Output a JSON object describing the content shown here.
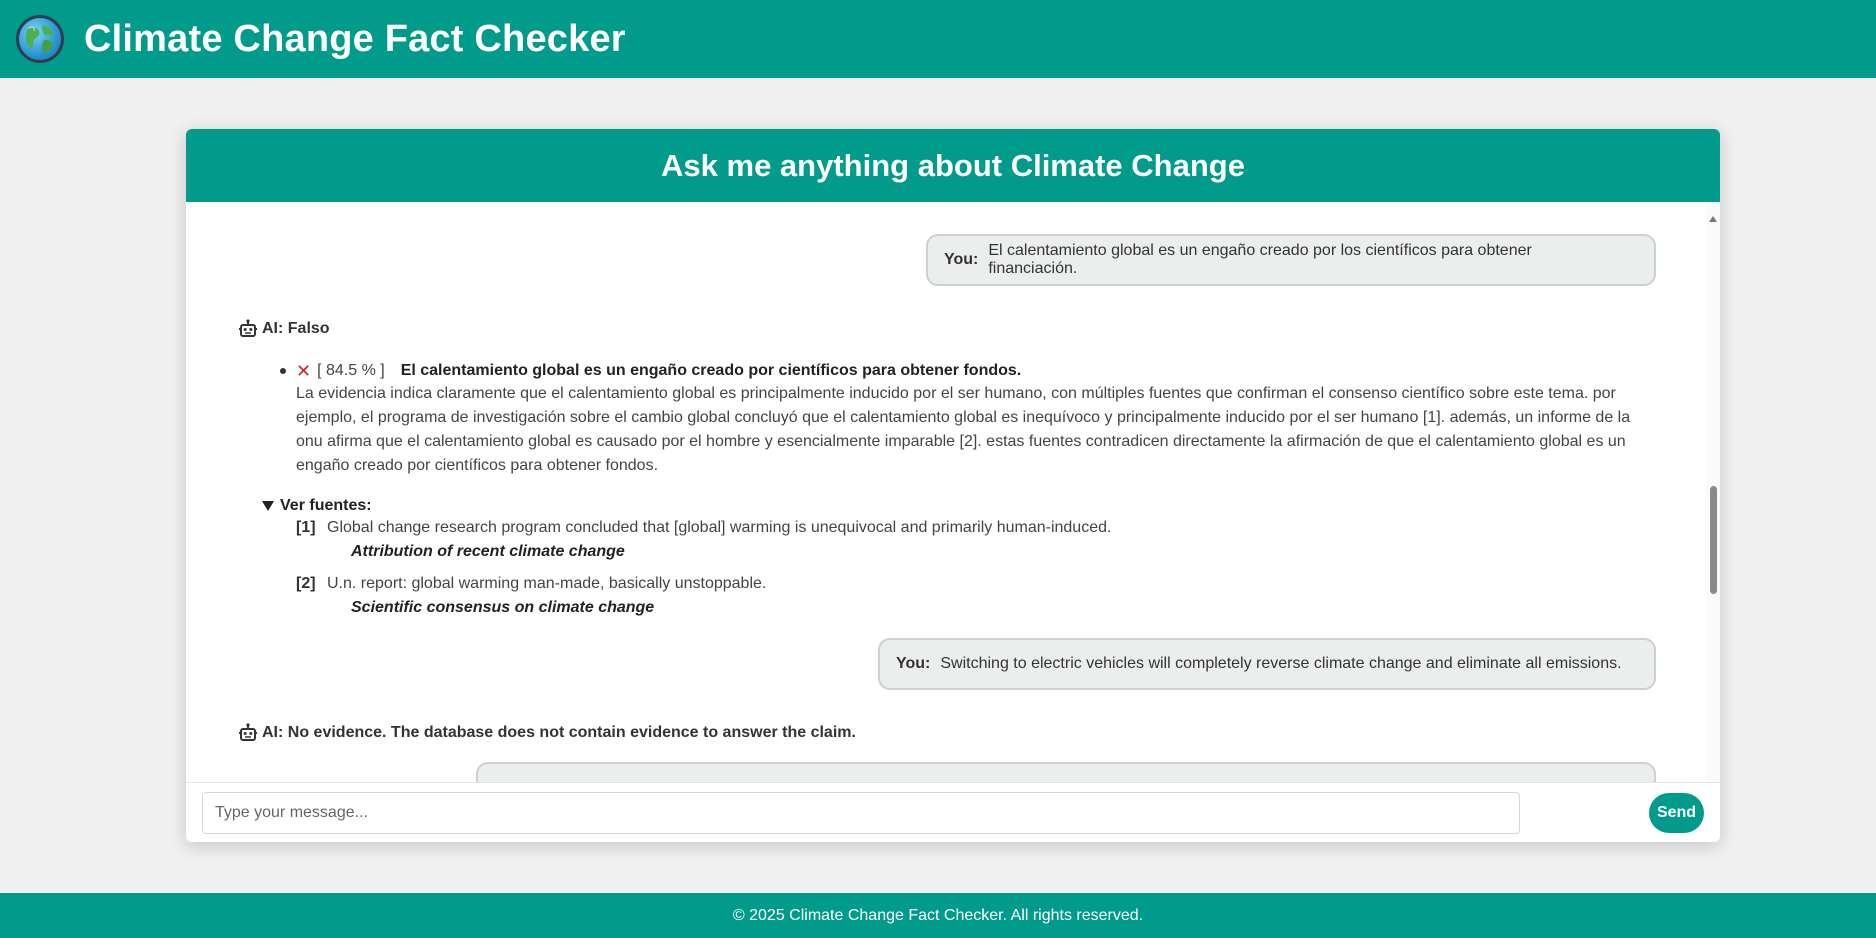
{
  "app": {
    "title": "Climate Change Fact Checker"
  },
  "chat": {
    "header": "Ask me anything about Climate Change",
    "messages": [
      {
        "role": "user",
        "label": "You:",
        "text": "El calentamiento global es un engaño creado por los científicos para obtener financiación."
      },
      {
        "role": "ai",
        "label": "AI: Falso",
        "claim": {
          "mark": "✕",
          "score": "[ 84.5 % ]",
          "text": "El calentamiento global es un engaño creado por científicos para obtener fondos.",
          "explanation_lines": [
            "La evidencia indica claramente que el calentamiento global es principalmente inducido por el ser humano, con múltiples fuentes que confirman el consenso científico sobre este tema. por",
            "ejemplo, el programa de investigación sobre el cambio global concluyó que el calentamiento global es inequívoco y principalmente inducido por el ser humano [1]. además, un informe de la",
            "onu afirma que el calentamiento global es causado por el hombre y esencialmente imparable [2]. estas fuentes contradicen directamente la afirmación de que el calentamiento global es un",
            "engaño creado por científicos para obtener fondos."
          ]
        },
        "sources": {
          "summary": "Ver fuentes:",
          "items": [
            {
              "num": "[1]",
              "text": "Global change research program concluded that [global] warming is unequivocal and primarily human-induced.",
              "title": "Attribution of recent climate change"
            },
            {
              "num": "[2]",
              "text": "U.n. report: global warming man-made, basically unstoppable.",
              "title": "Scientific consensus on climate change"
            }
          ]
        }
      },
      {
        "role": "user",
        "label": "You:",
        "text": "Switching to electric vehicles will completely reverse climate change and eliminate all emissions."
      },
      {
        "role": "ai",
        "label": "AI: No evidence. The database does not contain evidence to answer the claim."
      }
    ]
  },
  "input": {
    "placeholder": "Type your message...",
    "value": ""
  },
  "send_button": {
    "label": "Send"
  },
  "footer": {
    "text": "© 2025 Climate Change Fact Checker. All rights reserved."
  },
  "colors": {
    "brand": "#009b8a",
    "false_mark": "#d0242b",
    "user_bubble_bg": "#eceeee",
    "page_bg": "#f0f0f0"
  },
  "icons": {
    "logo": "globe-icon",
    "ai_avatar": "robot-icon",
    "verdict": "x-mark-icon",
    "disclosure": "triangle-down-icon"
  }
}
